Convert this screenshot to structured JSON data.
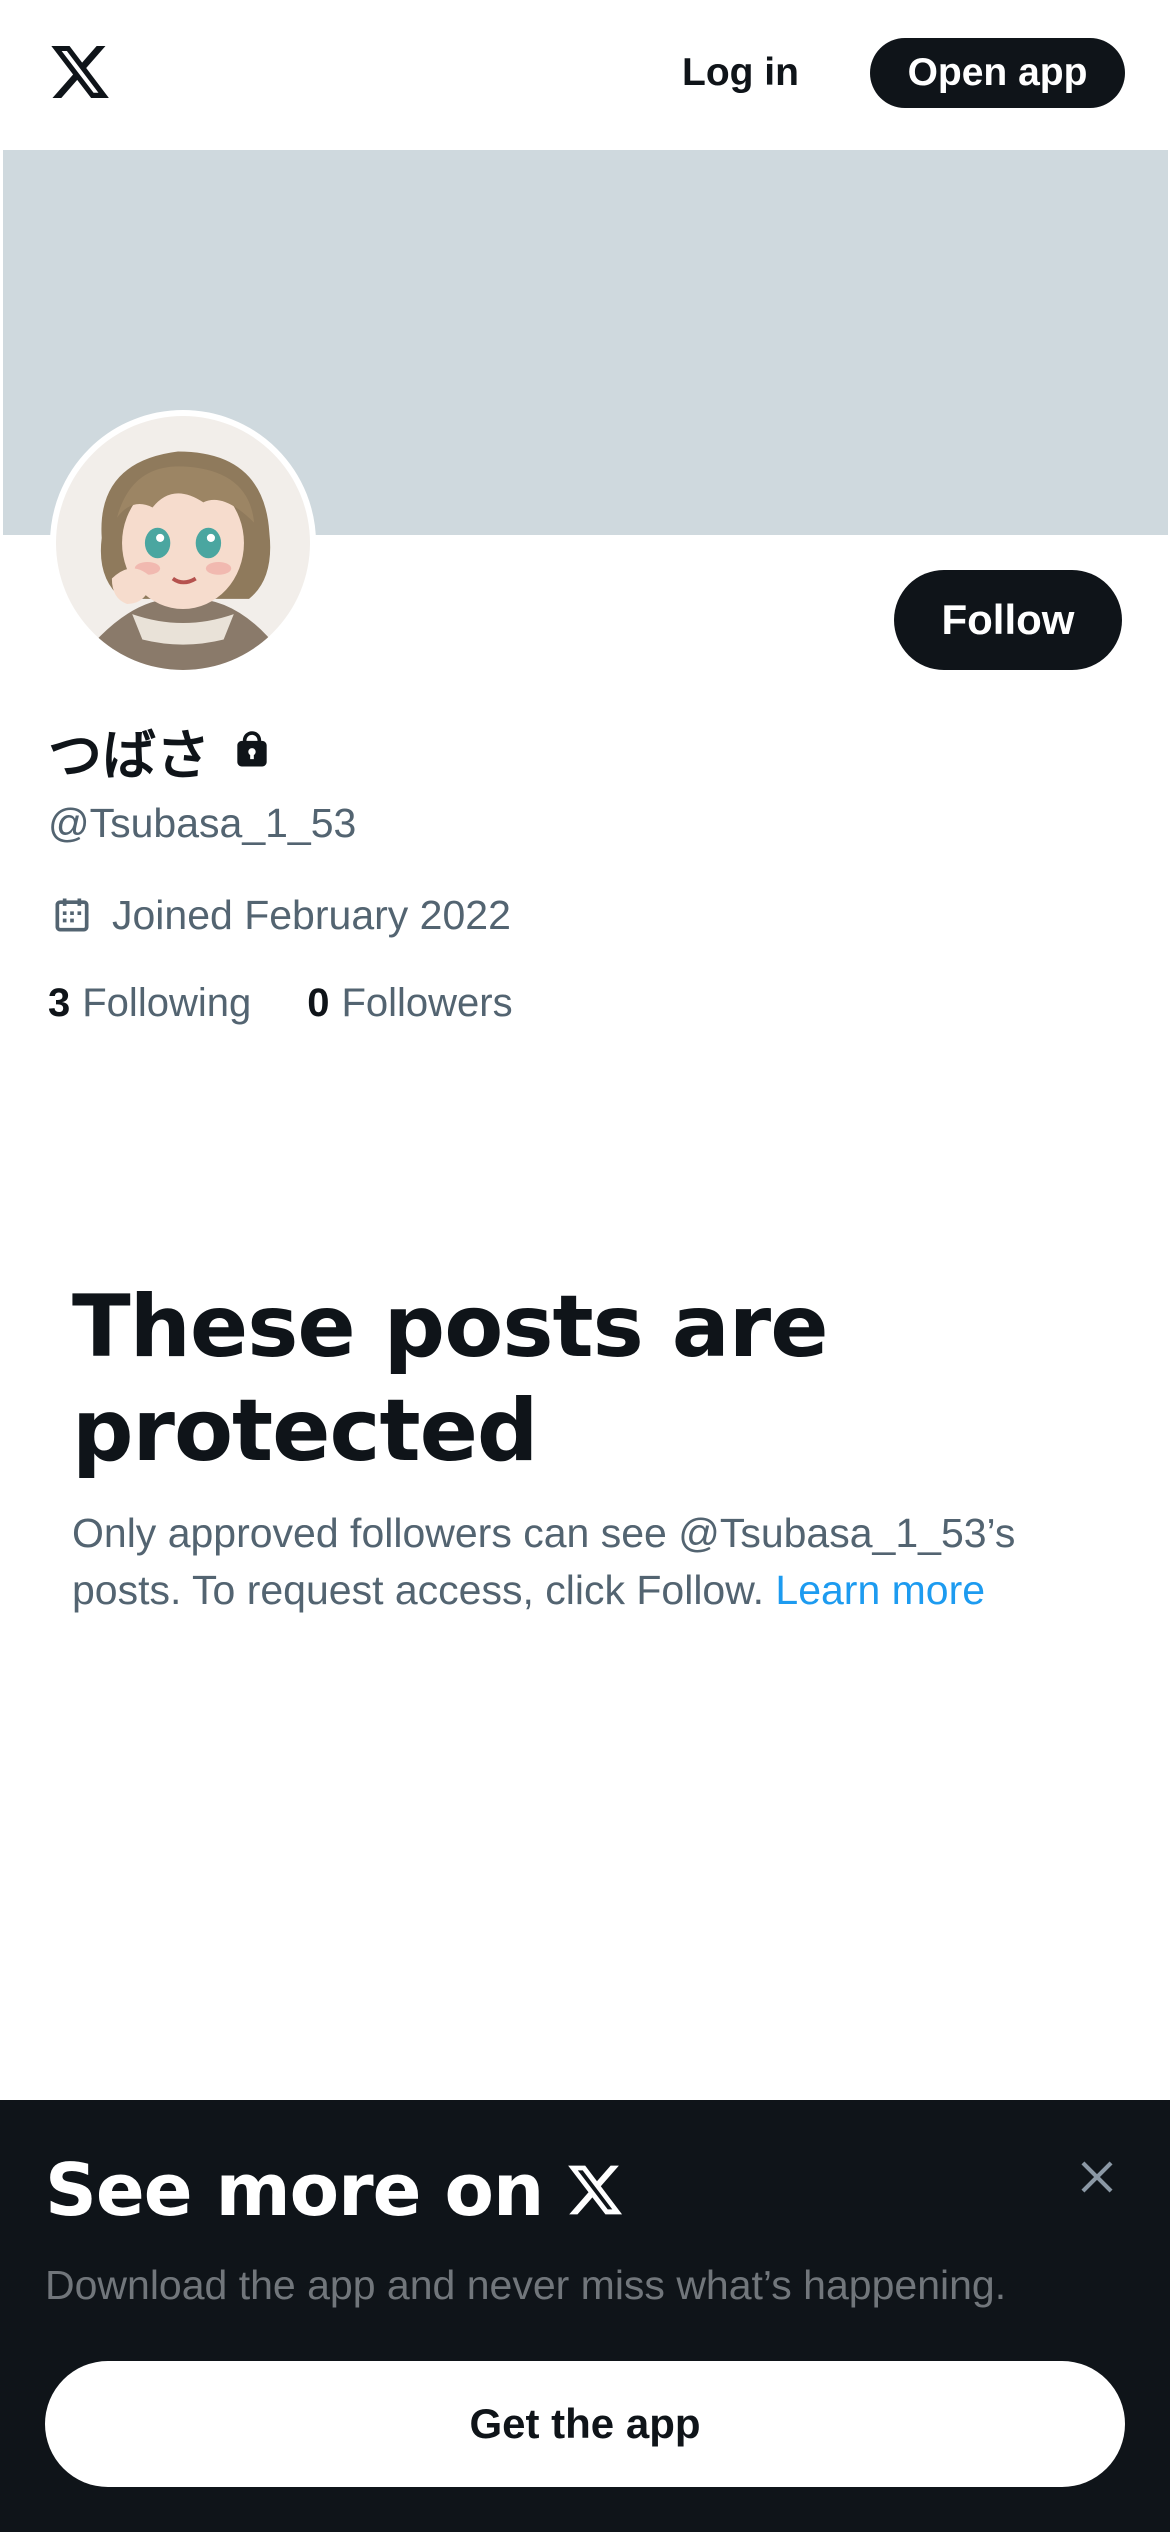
{
  "topbar": {
    "logo_icon": "x-logo-icon",
    "login_label": "Log in",
    "open_app_label": "Open app"
  },
  "profile": {
    "display_name": "つばさ",
    "protected_icon": "lock-icon",
    "handle": "@Tsubasa_1_53",
    "joined_icon": "calendar-icon",
    "joined": "Joined February 2022",
    "follow_label": "Follow",
    "following_count": "3",
    "following_label": "Following",
    "followers_count": "0",
    "followers_label": "Followers",
    "banner_color": "#cfd9de"
  },
  "protected": {
    "title": "These posts are protected",
    "body": "Only approved followers can see @Tsubasa_1_53’s posts. To request access, click Follow.",
    "learn_more": "Learn more"
  },
  "sheet": {
    "title": "See more on",
    "subtitle": "Download the app and never miss what’s happening.",
    "cta_label": "Get the app",
    "close_icon": "close-icon"
  },
  "colors": {
    "text_primary": "#0f1419",
    "text_secondary": "#536471",
    "link": "#1d9bf0",
    "sheet_bg": "#0f1419"
  }
}
